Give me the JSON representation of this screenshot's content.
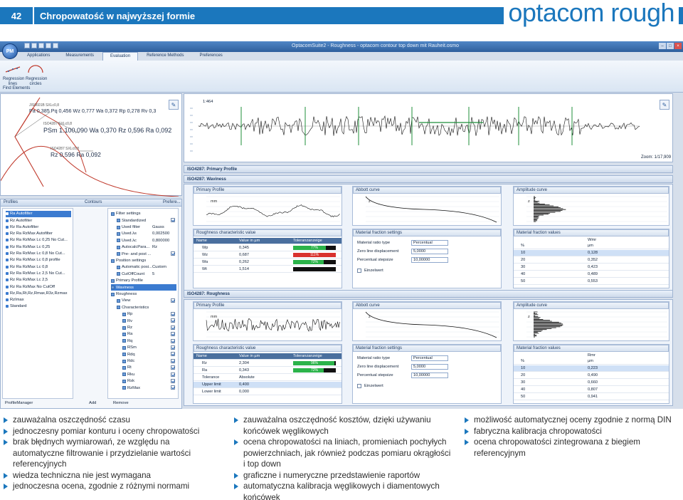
{
  "header": {
    "page_number": "42",
    "title": "Chropowatość w najwyższej formie",
    "brand": "optacom rough"
  },
  "app": {
    "logo": "PM",
    "window_title": "OptacomSuite2 - Roughness - optacom contour top down mit Rauheit.osmo",
    "tabs": [
      "Applications",
      "Measurements",
      "Evaluation",
      "Reference Methods",
      "Preferences"
    ],
    "active_tab": "Evaluation",
    "ribbon_buttons": [
      "Regression lines",
      "Regression circles"
    ],
    "ribbon_group": "Find Elements",
    "overview": {
      "annotations": [
        "JIS0601B SXLc0,8\nPa 0,385 Pq 0,456 Wz 0,777 Wa 0,372 Rp 0,278 Rv 0,3",
        "ISO4287 SXLc0,8\nPSm 1.100,090 Wa 0,370 Rz 0,596 Ra 0,092",
        "ISO4287 SXLc0,8\nRz 0,596 Ra 0,092"
      ],
      "top_label": "1:464",
      "zoom": "Zoom: 1/17,909"
    },
    "left_tabs": [
      "Profiles",
      "Contours",
      "Prefere..."
    ],
    "profiles": [
      "Ra Autofilter",
      "Rz Autofilter",
      "Rz Ra Autofilter",
      "Rz Ra RzMax Autofilter",
      "Rz Ra RzMax Lc 0,25 No Cut...",
      "Rz Ra RzMax Lc 0,25",
      "Rz Ra RzMax Lc 0,8 No Cut...",
      "Rz Ra RzMax Lc 0,8 profile",
      "Rz Ra RzMax Lc 0,8",
      "Rz Ra RzMax Lc 2,5 No Cut...",
      "Rz Ra RzMax Lc 2,5",
      "Rz Ra RzMax No CutOff",
      "Rz,Ra,Rt,Rz,Rmax,R3z,Rzmax",
      "RzImax",
      "Standard"
    ],
    "profiles_footer": "ProfileManager",
    "tree": [
      {
        "label": "Filter settings",
        "value": "",
        "lvl": 0
      },
      {
        "label": "Standardized",
        "value": "",
        "lvl": 1,
        "cb": true
      },
      {
        "label": "Used filter",
        "value": "Gauss",
        "lvl": 1
      },
      {
        "label": "Used.λs",
        "value": "0,002500",
        "lvl": 1
      },
      {
        "label": "Used.λc",
        "value": "0,800000",
        "lvl": 1
      },
      {
        "label": "AutocalcPara...",
        "value": "Rz",
        "lvl": 1
      },
      {
        "label": "Pre- and post ...",
        "value": "",
        "lvl": 1,
        "cb": true
      },
      {
        "label": "Position settings",
        "value": "",
        "lvl": 0
      },
      {
        "label": "Automatic posi...",
        "value": "Custom",
        "lvl": 1
      },
      {
        "label": "CutOffCount",
        "value": "5",
        "lvl": 1
      },
      {
        "label": "Primary Profile",
        "value": "",
        "lvl": 0
      },
      {
        "label": "Waviness",
        "value": "",
        "lvl": 0,
        "sel": true
      },
      {
        "label": "Roughness",
        "value": "",
        "lvl": 0
      },
      {
        "label": "View",
        "value": "",
        "lvl": 1,
        "cb": true
      },
      {
        "label": "Characteristics",
        "value": "",
        "lvl": 1
      },
      {
        "label": "Rp",
        "value": "",
        "lvl": 2,
        "cb": true
      },
      {
        "label": "Rv",
        "value": "",
        "lvl": 2,
        "cb": true
      },
      {
        "label": "Rz",
        "value": "",
        "lvl": 2,
        "cb": true
      },
      {
        "label": "Ra",
        "value": "",
        "lvl": 2,
        "cb": true
      },
      {
        "label": "Rq",
        "value": "",
        "lvl": 2,
        "cb": true
      },
      {
        "label": "RSm",
        "value": "",
        "lvl": 2,
        "cb": true
      },
      {
        "label": "Rdq",
        "value": "",
        "lvl": 2,
        "cb": true
      },
      {
        "label": "Rdc",
        "value": "",
        "lvl": 2,
        "cb": true
      },
      {
        "label": "Rt",
        "value": "",
        "lvl": 2,
        "cb": true
      },
      {
        "label": "Rku",
        "value": "",
        "lvl": 2,
        "cb": true
      },
      {
        "label": "Rsk",
        "value": "",
        "lvl": 2,
        "cb": true
      },
      {
        "label": "RzMax",
        "value": "",
        "lvl": 2,
        "cb": true
      }
    ],
    "tree_buttons": [
      "Add",
      "Remove"
    ],
    "sections": [
      "ISO4287: Primary Profile",
      "ISO4287: Waviness",
      "ISO4287: Roughness"
    ],
    "panels": {
      "primary": "Primary Profile",
      "abbott": "Abbott curve",
      "amplitude": "Amplitude curve",
      "roughness_char": "Roughness characteristic value",
      "material_ratio": "Material fraction settings",
      "material_fraction": "Material fraction values"
    },
    "chart_labels": {
      "mm": "mm",
      "z": "z",
      "um": "µm"
    },
    "waviness_table": {
      "headers": [
        "Name",
        "Value in µm",
        "Toleranzanzeige"
      ],
      "rows": [
        {
          "name": "Wp",
          "value": "0,345",
          "tol": "77%",
          "color": "#2bb34a",
          "frac": 0.77
        },
        {
          "name": "Wz",
          "value": "0,687",
          "tol": "111%",
          "color": "#d9322e",
          "frac": 1.0
        },
        {
          "name": "Wa",
          "value": "0,262",
          "tol": "72%",
          "color": "#2bb34a",
          "frac": 0.72
        },
        {
          "name": "Wt",
          "value": "1,514",
          "tol": "",
          "color": "#2bb34a",
          "frac": 0
        }
      ]
    },
    "roughness_table": {
      "headers": [
        "Name",
        "Value in µm",
        "Toleranzanzeige"
      ],
      "rows": [
        {
          "name": "Rz",
          "value": "2,304",
          "tol": "96%",
          "color": "#2bb34a",
          "frac": 0.96
        },
        {
          "name": "Ra",
          "value": "0,343",
          "tol": "72%",
          "color": "#2bb34a",
          "frac": 0.72
        },
        {
          "name": "Tolerance",
          "value": "Absolute",
          "tol": "",
          "color": "",
          "frac": 0
        },
        {
          "name": "Upper limit",
          "value": "0,400",
          "tol": "",
          "color": "",
          "frac": 0,
          "sel": true
        },
        {
          "name": "Lower limit",
          "value": "0,000",
          "tol": "",
          "color": "",
          "frac": 0
        }
      ]
    },
    "material_settings": {
      "rows": [
        {
          "label": "Material ratio type",
          "value": "Percentual"
        },
        {
          "label": "Zero line displacement",
          "value": "5,0000"
        },
        {
          "label": "Percentual stepsize",
          "value": "10,00000"
        }
      ],
      "checkbox": "Einzelwert"
    },
    "material_values_waviness": {
      "head": "Wmr",
      "cols": [
        "%",
        "µm"
      ],
      "rows": [
        [
          "10",
          "0,128"
        ],
        [
          "20",
          "0,352"
        ],
        [
          "30",
          "0,423"
        ],
        [
          "40",
          "0,489"
        ],
        [
          "50",
          "0,553"
        ]
      ]
    },
    "material_values_roughness": {
      "head": "Rmr",
      "cols": [
        "%",
        "µm"
      ],
      "rows": [
        [
          "10",
          "0,223"
        ],
        [
          "20",
          "0,490"
        ],
        [
          "30",
          "0,660"
        ],
        [
          "40",
          "0,807"
        ],
        [
          "50",
          "0,941"
        ]
      ]
    }
  },
  "bullets": {
    "col1": [
      "zauważalna oszczędność czasu",
      "jednoczesny pomiar konturu i oceny chropowatości",
      "brak błędnych wymiarowań, ze względu na automatyczne filtrowanie i przydzielanie wartości referencyjnych",
      "wiedza techniczna nie jest wymagana",
      "jednoczesna ocena, zgodnie z różnymi normami"
    ],
    "col2": [
      "zauważalna oszczędność kosztów, dzięki używaniu końcówek węglikowych",
      "ocena chropowatości na liniach, promieniach pochyłych powierzchniach, jak również podczas pomiaru okrągłości i top down",
      "graficzne i numeryczne przedstawienie raportów",
      "automatyczna kalibracja węglikowych i diamentowych końcówek"
    ],
    "col3": [
      "możliwość automatycznej oceny zgodnie z normą DIN",
      "fabryczna kalibracja chropowatości",
      "ocena chropowatości zintegrowana z biegiem referencyjnym"
    ]
  },
  "colors": {
    "brand_blue": "#1b77bd",
    "ok_green": "#2bb34a",
    "bad_red": "#d9322e",
    "selection": "#3b7bd0"
  }
}
